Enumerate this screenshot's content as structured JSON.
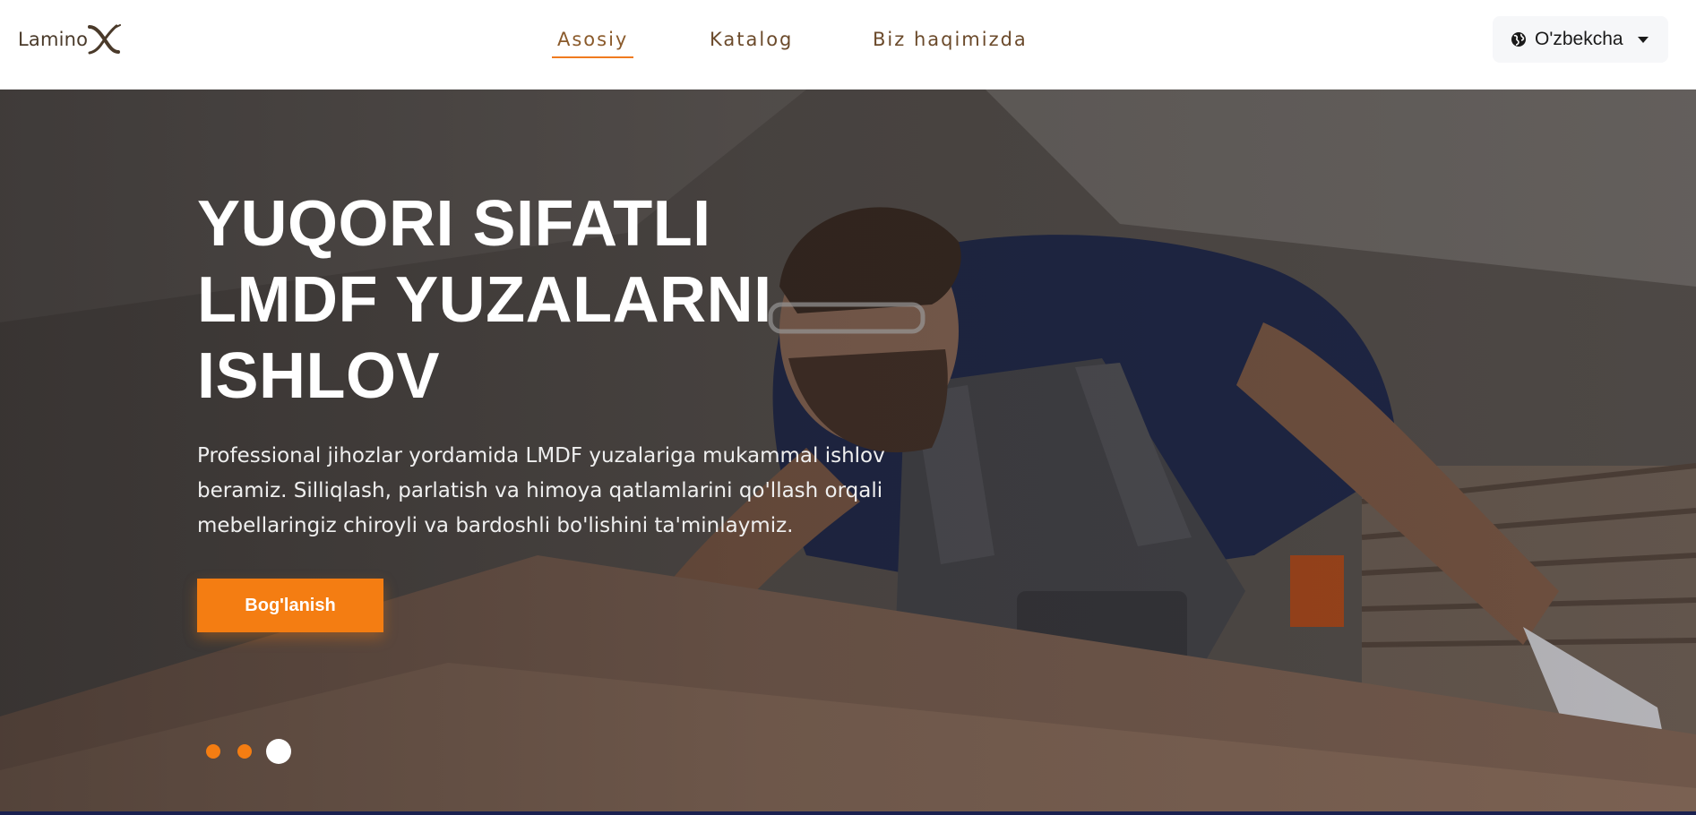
{
  "header": {
    "logo": {
      "text": "Lamino",
      "mark": "X"
    },
    "nav": [
      {
        "label": "Asosiy",
        "active": true
      },
      {
        "label": "Katalog",
        "active": false
      },
      {
        "label": "Biz haqimizda",
        "active": false
      }
    ],
    "language": {
      "label": "O'zbekcha",
      "icon": "globe-icon"
    }
  },
  "hero": {
    "title_lines": [
      "YUQORI SIFATLI",
      "LMDF YUZALARNI",
      "ISHLOV"
    ],
    "description_lines": [
      "Professional jihozlar yordamida LMDF yuzalariga mukammal ishlov",
      "beramiz. Silliqlash, parlatish va himoya qatlamlarini qo'llash orqali",
      "mebellaringiz chiroyli va bardoshli bo'lishini ta'minlaymiz."
    ],
    "cta_label": "Bog'lanish",
    "carousel": {
      "slides": 3,
      "active_index": 2
    }
  },
  "colors": {
    "accent": "#f47d12",
    "nav_text": "#6b4a2b",
    "logo": "#4a3a2a"
  }
}
